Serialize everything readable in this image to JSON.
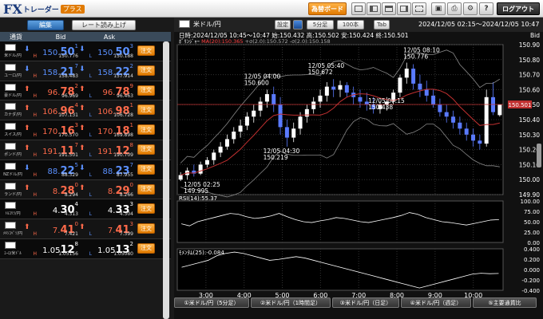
{
  "app": {
    "logo_main": "FX",
    "logo_sub": "トレーダー",
    "logo_plus": "プラス"
  },
  "toolbar": {
    "board_btn": "為替ボード",
    "logout_btn": "ログアウト"
  },
  "left_panel": {
    "tab_edit": "編集",
    "tab_read": "レート読み上げ",
    "head_currency": "通貨",
    "head_bid": "Bid",
    "head_ask": "Ask",
    "order_label": "注文",
    "high_label": "H",
    "low_label": "L",
    "rows": [
      {
        "pair": "米ドル/円",
        "dir": "down",
        "bid_pre": "150.",
        "bid_big": "50",
        "bid_small": "1",
        "ask_pre": "150.",
        "ask_big": "50",
        "ask_small": "3",
        "high": "150.776",
        "low": "150.188"
      },
      {
        "pair": "ユーロ/円",
        "dir": "down",
        "bid_pre": "158.",
        "bid_big": "21",
        "bid_small": "7",
        "ask_pre": "158.",
        "ask_big": "22",
        "ask_small": "2",
        "high": "158.483",
        "low": "157.914"
      },
      {
        "pair": "豪ドル/円",
        "dir": "up",
        "bid_pre": "96.",
        "bid_big": "78",
        "bid_small": "2",
        "ask_pre": "96.",
        "ask_big": "78",
        "ask_small": "9",
        "high": "96.969",
        "low": "96.463"
      },
      {
        "pair": "カナダ/円",
        "dir": "up",
        "bid_pre": "106.",
        "bid_big": "96",
        "bid_small": "4",
        "ask_pre": "106.",
        "ask_big": "98",
        "ask_small": "1",
        "high": "107.131",
        "low": "106.728"
      },
      {
        "pair": "スイス/円",
        "dir": "up",
        "bid_pre": "170.",
        "bid_big": "16",
        "bid_small": "3",
        "ask_pre": "170.",
        "ask_big": "18",
        "ask_small": "1",
        "high": "170.570",
        "low": "169.898"
      },
      {
        "pair": "ポンド/円",
        "dir": "up",
        "bid_pre": "191.",
        "bid_big": "11",
        "bid_small": "7",
        "ask_pre": "191.",
        "ask_big": "12",
        "ask_small": "8",
        "high": "191.501",
        "low": "190.709"
      },
      {
        "pair": "NZドル/円",
        "dir": "down",
        "bid_pre": "88.",
        "bid_big": "22",
        "bid_small": "5",
        "ask_pre": "88.",
        "ask_big": "23",
        "ask_small": "7",
        "high": "88.329",
        "low": "87.955"
      },
      {
        "pair": "ランド/円",
        "dir": "up",
        "bid_pre": "8.",
        "bid_big": "28",
        "bid_small": "0",
        "ask_pre": "8.",
        "ask_big": "29",
        "ask_small": "0",
        "high": "8.294",
        "low": "8.266"
      },
      {
        "pair": "ﾄﾙｺﾘﾗ/円",
        "dir": "neutral",
        "bid_pre": "4.",
        "bid_big": "30",
        "bid_small": "4",
        "ask_pre": "4.",
        "ask_big": "33",
        "ask_small": "3",
        "high": "4.313",
        "low": "4.304"
      },
      {
        "pair": "ﾒｷｼｺﾍﾟｿ/円",
        "dir": "up",
        "bid_pre": "7.",
        "bid_big": "41",
        "bid_small": "0",
        "ask_pre": "7.",
        "ask_big": "41",
        "ask_small": "3",
        "high": "7.421",
        "low": "7.399"
      },
      {
        "pair": "ﾕｰﾛ/米ﾄﾞﾙ",
        "dir": "neutral",
        "bid_pre": "1.05",
        "bid_big": "12",
        "bid_small": "8",
        "ask_pre": "1.05",
        "ask_big": "13",
        "ask_small": "2",
        "high": "1.05156",
        "low": "1.05080"
      }
    ]
  },
  "right_panel": {
    "pair_title": "米ドル/円",
    "settings_btn": "設定",
    "interval_btn": "5分足",
    "count_btn": "100本",
    "tab_btn": "Tab",
    "range_text": "2024/12/05 02:15〜2024/12/05 10:47",
    "tabs": [
      "①米ドル/円（5分足）",
      "②米ドル/円（1時間足）",
      "③米ドル/円（日足）",
      "④米ドル/円（週足）",
      "⑤主要通貨比"
    ]
  },
  "chart_data": {
    "type": "candlestick",
    "info_line": "日時:2024/12/05 10:45〜10:47  始:150.432  高:150.502  安:150.424  終:150.501",
    "bid_label": "Bid",
    "overlay_label_prefix": "ﾎﾞﾘﾝｼﾞｬｰ",
    "overlay_ma": "MA(20):150.365",
    "overlay_plus": "+σ(2.0):150.572",
    "overlay_minus": "-σ(2.0):150.158",
    "current_price_label": "150.501",
    "current_price": 150.501,
    "y_ticks": [
      "150.90",
      "150.80",
      "150.70",
      "150.60",
      "150.50",
      "150.40",
      "150.30",
      "150.20",
      "150.10",
      "150.00",
      "149.90"
    ],
    "ylim": [
      149.9,
      150.9
    ],
    "x_ticks": [
      "3:00",
      "4:00",
      "5:00",
      "6:00",
      "7:00",
      "8:00",
      "9:00",
      "10:00"
    ],
    "x_tick_hours": [
      3,
      4,
      5,
      6,
      7,
      8,
      9,
      10
    ],
    "x_start_hour": 2.25,
    "x_end_hour": 10.78,
    "annotations": [
      {
        "time": "12/05 02:25",
        "value": "149.995",
        "price": 149.995,
        "hour": 2.42
      },
      {
        "time": "12/05 04:00",
        "value": "150.600",
        "price": 150.6,
        "hour": 4.0
      },
      {
        "time": "12/05 04:30",
        "value": "150.219",
        "price": 150.219,
        "hour": 4.5
      },
      {
        "time": "12/05 05:40",
        "value": "150.672",
        "price": 150.672,
        "hour": 5.67
      },
      {
        "time": "12/05 07:15",
        "value": "150.438",
        "price": 150.438,
        "hour": 7.25
      },
      {
        "time": "12/05 08:10",
        "value": "150.776",
        "price": 150.776,
        "hour": 8.17
      }
    ],
    "rsi_label": "RSI(14):55.37",
    "rsi_ticks": [
      "100.00",
      "75.00",
      "50.00",
      "25.00",
      "0.00"
    ],
    "rsi_values": [
      45,
      40,
      50,
      55,
      60,
      65,
      70,
      68,
      62,
      58,
      60,
      64,
      70,
      62,
      55,
      50,
      48,
      52,
      55,
      60,
      58,
      54,
      50,
      48,
      52,
      56,
      60,
      65,
      72,
      68,
      60,
      55,
      50,
      48,
      45,
      42,
      46,
      50,
      54,
      55
    ],
    "mom_label": "ﾓﾒﾝﾀﾑ(25):-0.084",
    "mom_ticks": [
      "0.400",
      "0.200",
      "0.000",
      "-0.200",
      "-0.400"
    ],
    "mom_values": [
      0.05,
      0.1,
      0.15,
      0.2,
      0.3,
      0.35,
      0.38,
      0.35,
      0.3,
      0.25,
      0.2,
      0.22,
      0.25,
      0.28,
      0.25,
      0.2,
      0.15,
      0.1,
      0.05,
      0.0,
      -0.05,
      -0.1,
      -0.15,
      -0.2,
      -0.25,
      -0.3,
      -0.35,
      -0.4,
      -0.35,
      -0.3,
      -0.25,
      -0.2,
      -0.15,
      -0.1,
      -0.08,
      -0.09,
      -0.084
    ],
    "candles": [
      [
        150.0,
        150.05,
        149.99,
        150.03
      ],
      [
        150.03,
        150.08,
        150.0,
        150.06
      ],
      [
        150.06,
        150.1,
        150.02,
        150.04
      ],
      [
        150.04,
        150.12,
        150.03,
        150.1
      ],
      [
        150.1,
        150.15,
        150.08,
        150.13
      ],
      [
        150.13,
        150.2,
        150.1,
        150.18
      ],
      [
        150.18,
        150.25,
        150.15,
        150.22
      ],
      [
        150.22,
        150.3,
        150.2,
        150.27
      ],
      [
        150.27,
        150.35,
        150.24,
        150.32
      ],
      [
        150.32,
        150.4,
        150.28,
        150.36
      ],
      [
        150.36,
        150.45,
        150.33,
        150.42
      ],
      [
        150.42,
        150.5,
        150.38,
        150.46
      ],
      [
        150.46,
        150.55,
        150.42,
        150.52
      ],
      [
        150.52,
        150.6,
        150.48,
        150.57
      ],
      [
        150.57,
        150.62,
        150.45,
        150.5
      ],
      [
        150.5,
        150.55,
        150.3,
        150.35
      ],
      [
        150.35,
        150.4,
        150.22,
        150.28
      ],
      [
        150.28,
        150.38,
        150.25,
        150.34
      ],
      [
        150.34,
        150.45,
        150.3,
        150.42
      ],
      [
        150.42,
        150.5,
        150.38,
        150.47
      ],
      [
        150.47,
        150.55,
        150.44,
        150.52
      ],
      [
        150.52,
        150.6,
        150.48,
        150.56
      ],
      [
        150.56,
        150.65,
        150.52,
        150.62
      ],
      [
        150.62,
        150.67,
        150.55,
        150.6
      ],
      [
        150.6,
        150.66,
        150.55,
        150.63
      ],
      [
        150.63,
        150.65,
        150.55,
        150.58
      ],
      [
        150.58,
        150.62,
        150.5,
        150.55
      ],
      [
        150.55,
        150.6,
        150.48,
        150.52
      ],
      [
        150.52,
        150.58,
        150.46,
        150.5
      ],
      [
        150.5,
        150.55,
        150.44,
        150.47
      ],
      [
        150.47,
        150.52,
        150.44,
        150.5
      ],
      [
        150.5,
        150.55,
        150.46,
        150.52
      ],
      [
        150.52,
        150.6,
        150.5,
        150.58
      ],
      [
        150.58,
        150.7,
        150.55,
        150.68
      ],
      [
        150.68,
        150.78,
        150.64,
        150.74
      ],
      [
        150.74,
        150.77,
        150.6,
        150.64
      ],
      [
        150.64,
        150.7,
        150.55,
        150.6
      ],
      [
        150.6,
        150.66,
        150.52,
        150.56
      ],
      [
        150.56,
        150.6,
        150.48,
        150.5
      ],
      [
        150.5,
        150.54,
        150.42,
        150.45
      ],
      [
        150.45,
        150.5,
        150.38,
        150.42
      ],
      [
        150.42,
        150.46,
        150.34,
        150.38
      ],
      [
        150.38,
        150.42,
        150.3,
        150.34
      ],
      [
        150.34,
        150.38,
        150.26,
        150.3
      ],
      [
        150.3,
        150.34,
        150.22,
        150.26
      ],
      [
        150.26,
        150.3,
        150.2,
        150.24
      ],
      [
        150.24,
        150.6,
        150.22,
        150.55
      ],
      [
        150.55,
        150.65,
        150.43,
        150.45
      ],
      [
        150.43,
        150.5,
        150.42,
        150.5
      ]
    ]
  },
  "colors": {
    "accent": "#e07a00",
    "bull": "#ffffff",
    "bear": "#5a7aff",
    "ma_line": "#c03030",
    "band_line": "#888888",
    "price_line": "#c03030"
  }
}
